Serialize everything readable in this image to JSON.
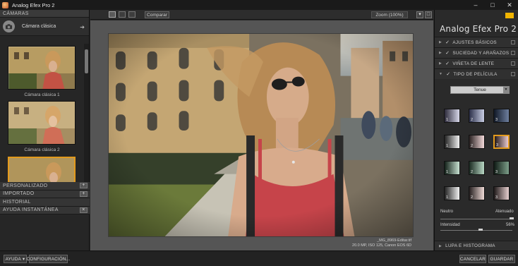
{
  "window": {
    "title": "Analog Efex Pro 2",
    "controls": [
      "–",
      "□",
      "✕"
    ]
  },
  "left": {
    "header": "CÁMARAS",
    "current_preset": "Cámara clásica",
    "thumbs": [
      "Cámara clásica 1",
      "Cámara clásica 2"
    ],
    "sections": [
      "PERSONALIZADO",
      "IMPORTADO",
      "HISTORIAL",
      "AYUDA INSTANTÁNEA"
    ]
  },
  "toolbar": {
    "compare": "Comparar",
    "zoom": "Zoom (100%)"
  },
  "photo": {
    "filename": "_MG_8969-Editar.tif",
    "meta": "20.0 MP, ISO 125, Canon EOS 6D"
  },
  "right": {
    "brand": "Analog Efex Pro",
    "brand_num": "2",
    "sections": [
      "AJUSTES BÁSICOS",
      "SUCIEDAD Y ARAÑAZOS",
      "VIÑETA DE LENTE",
      "TIPO DE PELÍCULA"
    ],
    "film_dropdown": "Tenue",
    "swatch_numbers": [
      "1",
      "2",
      "3"
    ],
    "slider1_left": "Neutro",
    "slider1_right": "Atenuado",
    "slider2_label": "Intensidad",
    "slider2_value": "56%",
    "lupa": "LUPA E HISTOGRAMA"
  },
  "bottom": {
    "help": "AYUDA",
    "config": "CONFIGURACIÓN...",
    "cancel": "CANCELAR",
    "save": "GUARDAR"
  },
  "colors": {
    "accent": "#e39a1d"
  }
}
